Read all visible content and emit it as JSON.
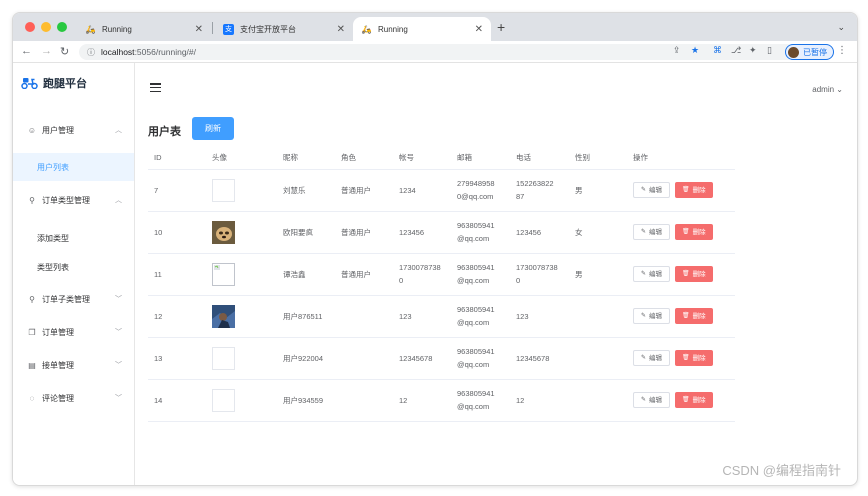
{
  "browser": {
    "tabs": [
      {
        "title": "Running",
        "active": false
      },
      {
        "title": "支付宝开放平台",
        "active": false
      },
      {
        "title": "Running",
        "active": true
      }
    ],
    "url_host": "localhost",
    "url_path": ":5056/running/#/",
    "profile_label": "已暂停"
  },
  "app": {
    "brand": "跑腿平台",
    "user": "admin",
    "sidebar": {
      "user_mgmt": "用户管理",
      "user_list": "用户列表",
      "order_type_mgmt": "订单类型管理",
      "add_type": "添加类型",
      "type_list": "类型列表",
      "order_subtype_mgmt": "订单子类管理",
      "order_mgmt": "订单管理",
      "accept_mgmt": "接单管理",
      "comment_mgmt": "评论管理"
    },
    "page_title": "用户表",
    "refresh": "刷新",
    "columns": [
      "ID",
      "头像",
      "昵称",
      "角色",
      "帐号",
      "邮箱",
      "电话",
      "性别",
      "操作"
    ],
    "edit": "编辑",
    "delete": "删除",
    "rows": [
      {
        "id": "7",
        "avatar": "empty",
        "nickname": "刘慧乐",
        "role": "普通用户",
        "account": "1234",
        "email_1": "279948958",
        "email_2": "0@qq.com",
        "phone_1": "152263822",
        "phone_2": "87",
        "gender": "男"
      },
      {
        "id": "10",
        "avatar": "dog",
        "nickname": "欧阳要疯",
        "role": "普通用户",
        "account": "123456",
        "email_1": "963805941",
        "email_2": "@qq.com",
        "phone_1": "123456",
        "phone_2": "",
        "gender": "女"
      },
      {
        "id": "11",
        "avatar": "broken",
        "nickname": "谭浩鑫",
        "role": "普通用户",
        "account_1": "1730078738",
        "account_2": "0",
        "email_1": "963805941",
        "email_2": "@qq.com",
        "phone_1": "1730078738",
        "phone_2": "0",
        "gender": "男"
      },
      {
        "id": "12",
        "avatar": "photo",
        "nickname": "用户876511",
        "role": "",
        "account": "123",
        "email_1": "963805941",
        "email_2": "@qq.com",
        "phone_1": "123",
        "phone_2": "",
        "gender": ""
      },
      {
        "id": "13",
        "avatar": "empty",
        "nickname": "用户922004",
        "role": "",
        "account": "12345678",
        "email_1": "963805941",
        "email_2": "@qq.com",
        "phone_1": "12345678",
        "phone_2": "",
        "gender": ""
      },
      {
        "id": "14",
        "avatar": "empty",
        "nickname": "用户934559",
        "role": "",
        "account": "12",
        "email_1": "963805941",
        "email_2": "@qq.com",
        "phone_1": "12",
        "phone_2": "",
        "gender": ""
      }
    ]
  },
  "watermark": "CSDN @编程指南针",
  "colors": {
    "primary": "#409eff",
    "danger": "#f56c6c",
    "active_bg": "#ecf5ff"
  }
}
